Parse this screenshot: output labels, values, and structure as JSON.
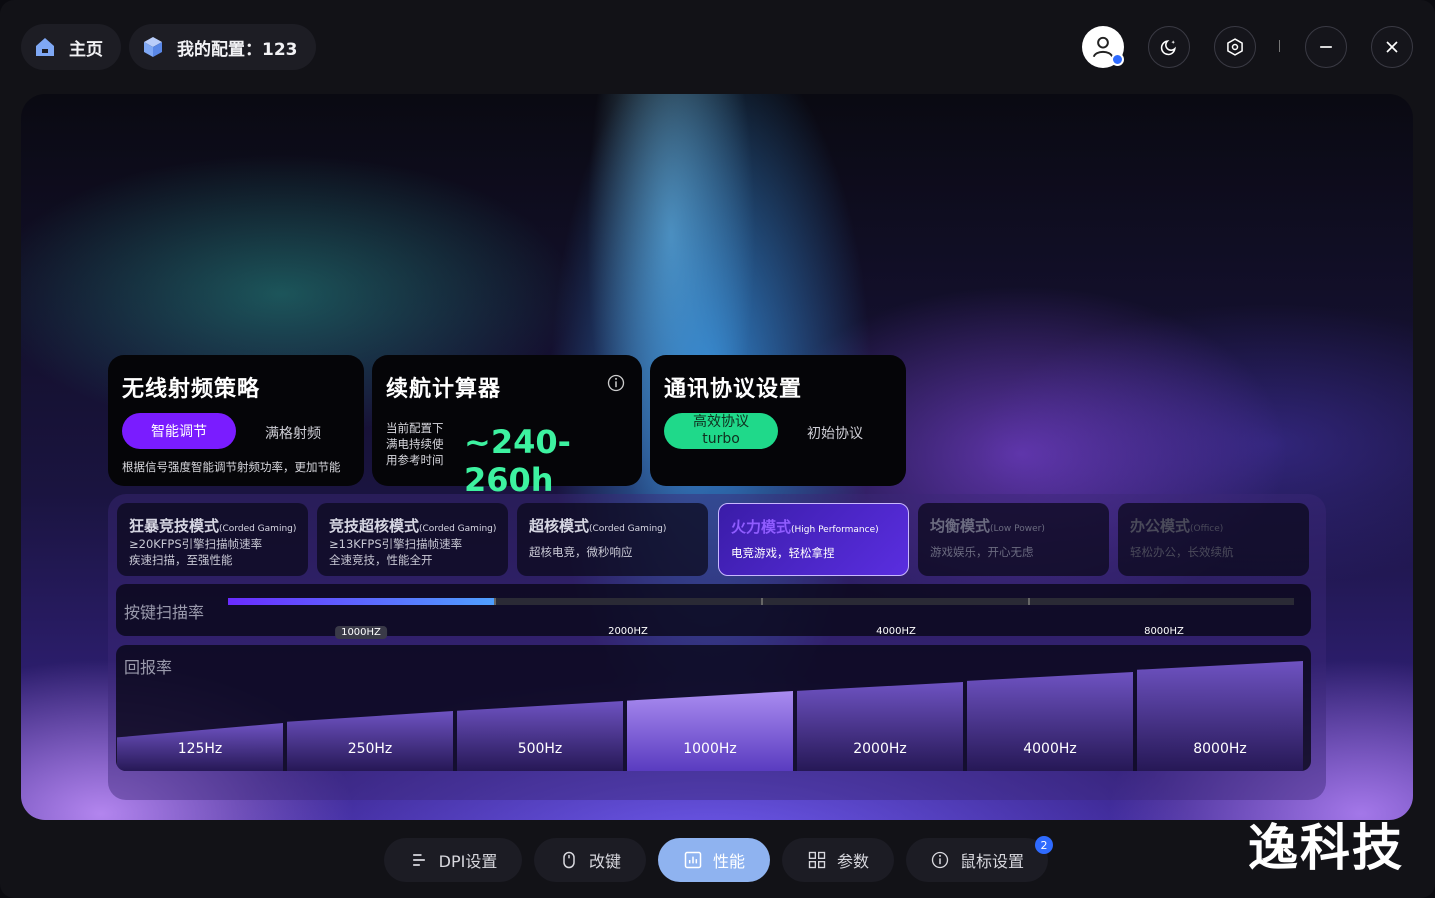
{
  "header": {
    "home_label": "主页",
    "config_label": "我的配置：123"
  },
  "cards": {
    "rf": {
      "title": "无线射频策略",
      "primary": "智能调节",
      "secondary": "满格射频",
      "note": "根据信号强度智能调节射频功率，更加节能"
    },
    "battery": {
      "title": "续航计算器",
      "desc_lines": [
        "当前配置下",
        "满电持续使",
        "用参考时间"
      ],
      "value": "~240-260h"
    },
    "protocol": {
      "title": "通讯协议设置",
      "primary_line1": "高效协议",
      "primary_line2": "turbo",
      "secondary": "初始协议"
    }
  },
  "modes": [
    {
      "title": "狂暴竞技模式",
      "tag": "(Corded Gaming)",
      "lines": [
        "≥20KFPS引擎扫描帧速率",
        "疾速扫描，至强性能"
      ]
    },
    {
      "title": "竞技超核模式",
      "tag": "(Corded Gaming)",
      "lines": [
        "≥13KFPS引擎扫描帧速率",
        "全速竞技，性能全开"
      ]
    },
    {
      "title": "超核模式",
      "tag": "(Corded Gaming)",
      "lines": [
        "超核电竞，微秒响应"
      ]
    },
    {
      "title": "火力模式",
      "tag": "(High Performance)",
      "lines": [
        "电竞游戏，轻松拿捏"
      ]
    },
    {
      "title": "均衡模式",
      "tag": "(Low Power)",
      "lines": [
        "游戏娱乐，开心无虑"
      ]
    },
    {
      "title": "办公模式",
      "tag": "(Office)",
      "lines": [
        "轻松办公，长效续航"
      ]
    }
  ],
  "scan_rate": {
    "label": "按键扫描率",
    "marks": [
      "1000HZ",
      "2000HZ",
      "4000HZ",
      "8000HZ"
    ],
    "selected": "1000HZ",
    "fill_fraction": 0.25
  },
  "report_rate": {
    "label": "回报率",
    "options": [
      "125Hz",
      "250Hz",
      "500Hz",
      "1000Hz",
      "2000Hz",
      "4000Hz",
      "8000Hz"
    ],
    "selected": "1000Hz"
  },
  "nav": {
    "dpi": "DPI设置",
    "keys": "改键",
    "perf": "性能",
    "params": "参数",
    "mouse": "鼠标设置",
    "mouse_badge": "2"
  },
  "watermark": "逸科技",
  "colors": {
    "accent_purple": "#6a2cff",
    "accent_green": "#1fd98a",
    "battery_value": "#3df2a0",
    "nav_active": "#8fb3f0"
  }
}
